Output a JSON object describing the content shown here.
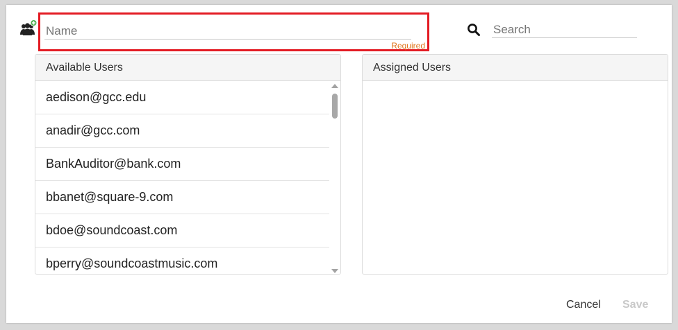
{
  "form": {
    "name_placeholder": "Name",
    "name_value": "",
    "required_label": "Required",
    "search_placeholder": "Search",
    "search_value": "",
    "highlight_color": "#e31b23",
    "required_color": "#e0741a",
    "group_icon": "users-group-add-icon",
    "search_icon": "magnifier-icon"
  },
  "available_users": {
    "header": "Available Users",
    "items": [
      "aedison@gcc.edu",
      "anadir@gcc.com",
      "BankAuditor@bank.com",
      "bbanet@square-9.com",
      "bdoe@soundcoast.com",
      "bperry@soundcoastmusic.com"
    ]
  },
  "assigned_users": {
    "header": "Assigned Users",
    "items": []
  },
  "footer": {
    "cancel_label": "Cancel",
    "save_label": "Save"
  }
}
